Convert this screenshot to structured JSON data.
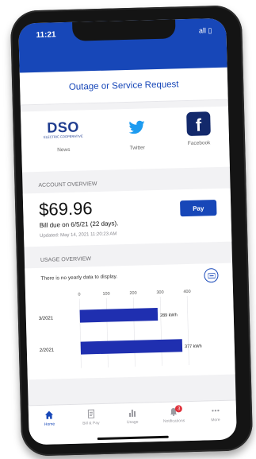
{
  "status": {
    "time": "11:21",
    "icons": "all ▯"
  },
  "request": {
    "label": "Outage or Service Request"
  },
  "social": {
    "dso_big": "DSO",
    "dso_small": "ELECTRIC COOPERATIVE",
    "news_label": "News",
    "twitter_label": "Twitter",
    "facebook_label": "Facebook"
  },
  "account": {
    "heading": "ACCOUNT OVERVIEW",
    "amount": "$69.96",
    "due": "Bill due on 6/5/21 (22 days).",
    "updated": "Updated: May 14, 2021 11:20:23 AM",
    "pay_label": "Pay"
  },
  "usage": {
    "heading": "USAGE OVERVIEW",
    "no_data": "There is no yearly data to display."
  },
  "chart_data": {
    "type": "bar",
    "orientation": "horizontal",
    "categories": [
      "3/2021",
      "2/2021"
    ],
    "values": [
      289,
      377
    ],
    "value_labels": [
      "289 kWh",
      "377 kWh"
    ],
    "xlim": [
      0,
      400
    ],
    "xticks": [
      "0",
      "100",
      "200",
      "300",
      "400"
    ],
    "bar_color": "#1f2fb0",
    "grid": true
  },
  "tabs": [
    {
      "label": "Home",
      "icon": "home-icon",
      "active": true
    },
    {
      "label": "Bill & Pay",
      "icon": "bill-icon",
      "active": false
    },
    {
      "label": "Usage",
      "icon": "usage-chart-icon",
      "active": false
    },
    {
      "label": "Notifications",
      "icon": "bell-icon",
      "active": false,
      "badge": "3"
    },
    {
      "label": "More",
      "icon": "more-icon",
      "active": false
    }
  ],
  "colors": {
    "brand": "#1747b8",
    "facebook": "#13296b",
    "badge": "#e0303a"
  }
}
